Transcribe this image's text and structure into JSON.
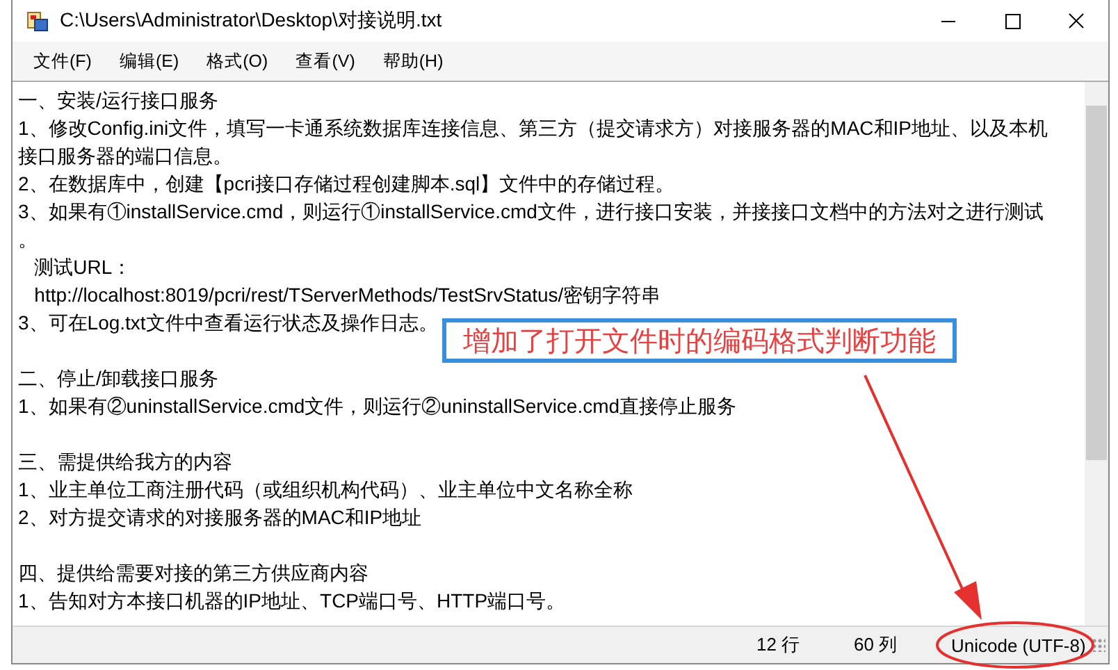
{
  "window": {
    "title": "C:\\Users\\Administrator\\Desktop\\对接说明.txt"
  },
  "menu": [
    "文件(F)",
    "编辑(E)",
    "格式(O)",
    "查看(V)",
    "帮助(H)"
  ],
  "document": {
    "blocks": [
      [
        "一、安装/运行接口服务",
        "1、修改Config.ini文件，填写一卡通系统数据库连接信息、第三方（提交请求方）对接服务器的MAC和IP地址、以及本机",
        "接口服务器的端口信息。",
        "2、在数据库中，创建【pcri接口存储过程创建脚本.sql】文件中的存储过程。",
        "3、如果有①installService.cmd，则运行①installService.cmd文件，进行接口安装，并接接口文档中的方法对之进行测试",
        "。",
        "   测试URL：",
        "   http://localhost:8019/pcri/rest/TServerMethods/TestSrvStatus/密钥字符串",
        "3、可在Log.txt文件中查看运行状态及操作日志。"
      ],
      [
        "二、停止/卸载接口服务",
        "1、如果有②uninstallService.cmd文件，则运行②uninstallService.cmd直接停止服务"
      ],
      [
        "三、需提供给我方的内容",
        "1、业主单位工商注册代码（或组织机构代码）、业主单位中文名称全称",
        "2、对方提交请求的对接服务器的MAC和IP地址"
      ],
      [
        "四、提供给需要对接的第三方供应商内容",
        "1、告知对方本接口机器的IP地址、TCP端口号、HTTP端口号。"
      ]
    ]
  },
  "status_bar": {
    "line": "12 行",
    "column": "60 列",
    "encoding": "Unicode (UTF-8)"
  },
  "annotation": {
    "text": "增加了打开文件时的编码格式判断功能"
  }
}
